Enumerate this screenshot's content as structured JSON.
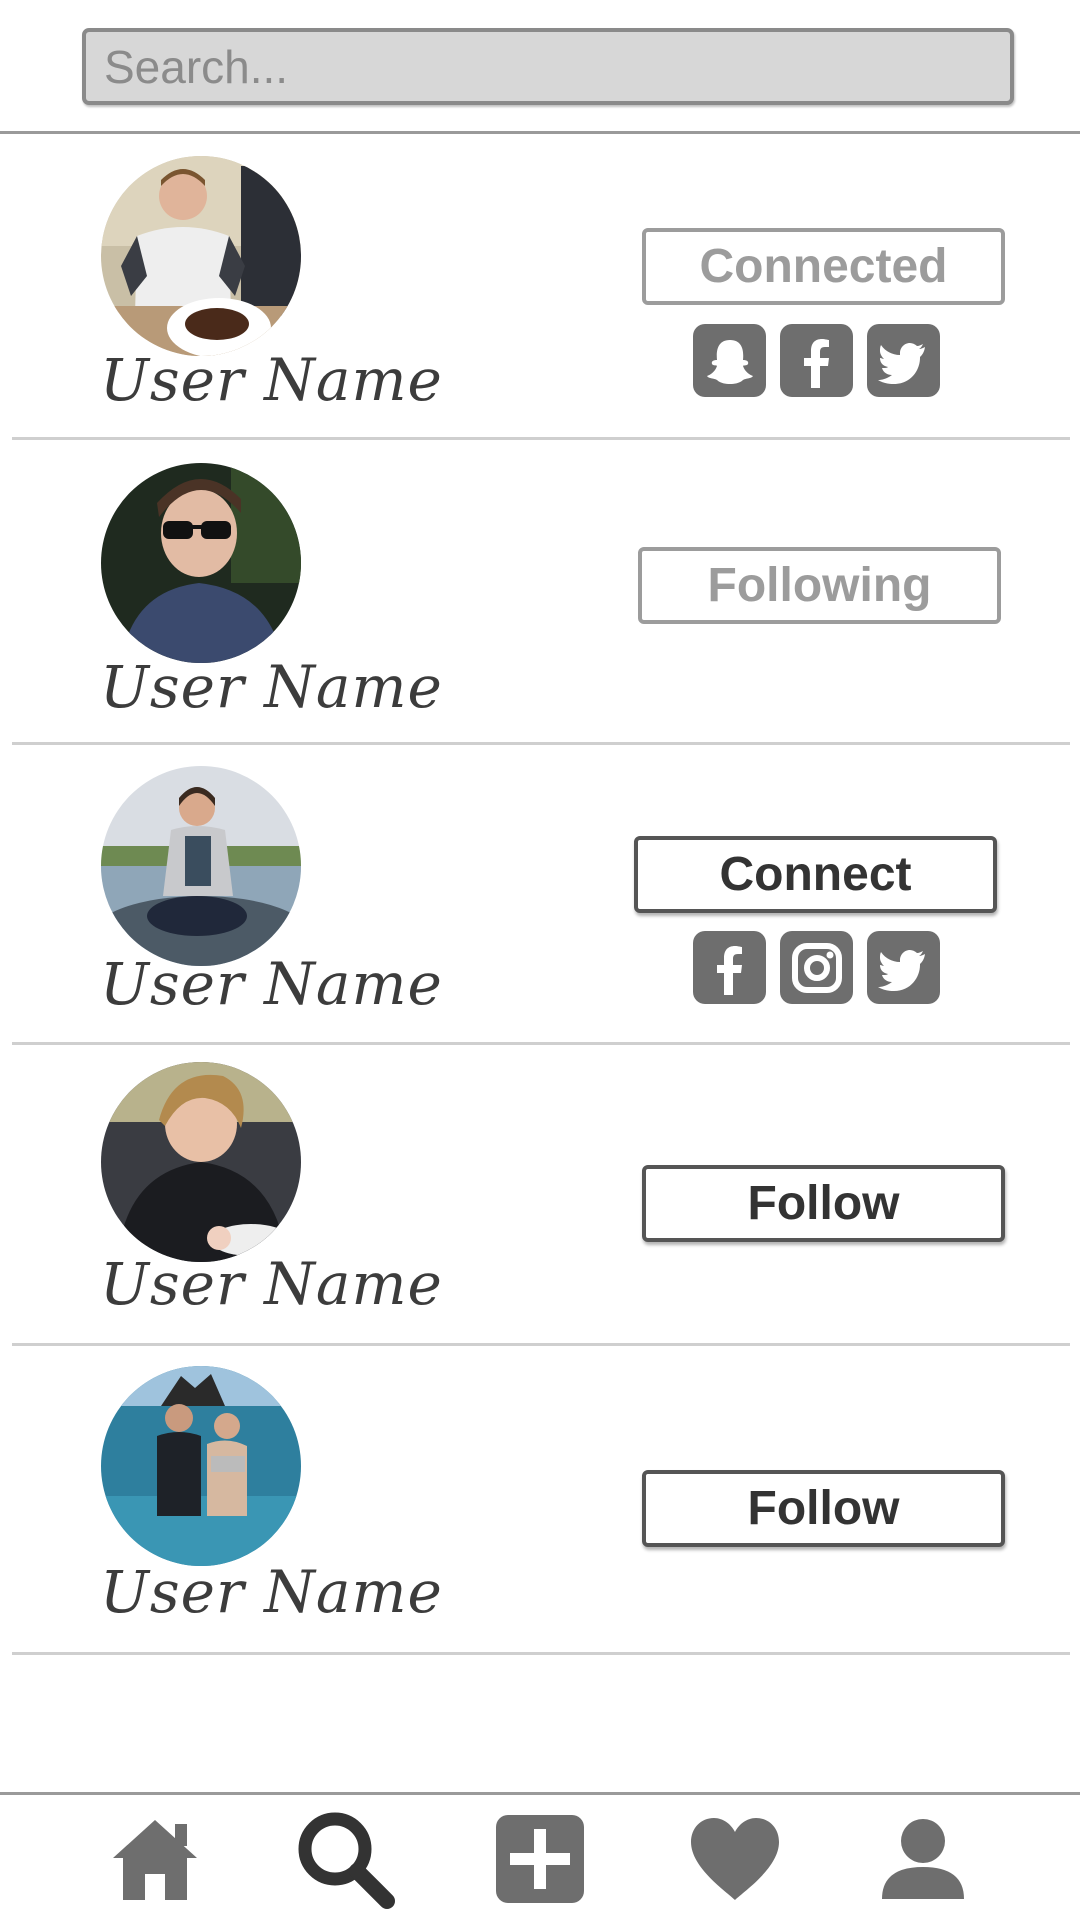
{
  "search": {
    "placeholder": "Search..."
  },
  "users": [
    {
      "name": "User Name",
      "action": "Connected",
      "action_style": "muted",
      "socials": [
        "snapchat-icon",
        "facebook-icon",
        "twitter-icon"
      ]
    },
    {
      "name": "User Name",
      "action": "Following",
      "action_style": "muted",
      "socials": []
    },
    {
      "name": "User Name",
      "action": "Connect",
      "action_style": "strong",
      "socials": [
        "facebook-icon",
        "instagram-icon",
        "twitter-icon"
      ]
    },
    {
      "name": "User Name",
      "action": "Follow",
      "action_style": "strong",
      "socials": []
    },
    {
      "name": "User Name",
      "action": "Follow",
      "action_style": "strong",
      "socials": []
    }
  ],
  "bottom_nav": [
    "home-icon",
    "search-icon",
    "add-post-icon",
    "likes-heart-icon",
    "profile-icon"
  ],
  "colors": {
    "search_bg": "#d7d7d7",
    "icon_gray": "#6e6e6e",
    "muted": "#9c9c9c",
    "strong": "#555555"
  }
}
